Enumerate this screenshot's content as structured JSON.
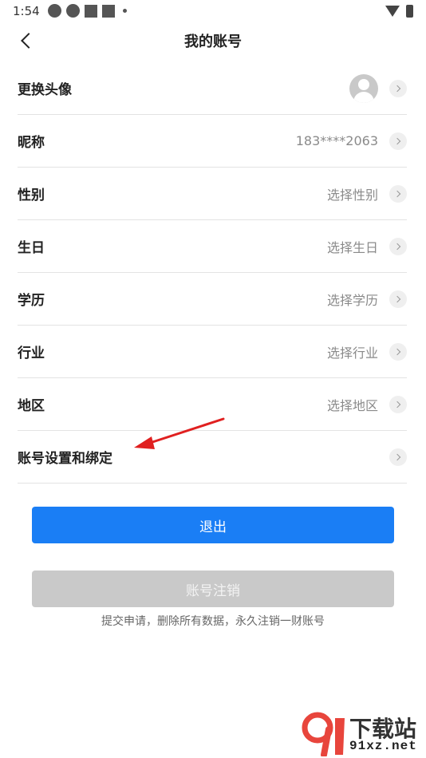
{
  "status_bar": {
    "time": "1:54",
    "left_icons": [
      "settings-icon",
      "browser-icon",
      "app-icon",
      "app-icon",
      "dot-icon"
    ],
    "right_icons": [
      "wifi-icon",
      "battery-icon"
    ]
  },
  "header": {
    "title": "我的账号",
    "back_icon": "chevron-left-icon"
  },
  "rows": [
    {
      "label": "更换头像",
      "value": "",
      "type": "avatar"
    },
    {
      "label": "昵称",
      "value": "183****2063"
    },
    {
      "label": "性别",
      "value": "选择性别"
    },
    {
      "label": "生日",
      "value": "选择生日"
    },
    {
      "label": "学历",
      "value": "选择学历"
    },
    {
      "label": "行业",
      "value": "选择行业"
    },
    {
      "label": "地区",
      "value": "选择地区"
    },
    {
      "label": "账号设置和绑定",
      "value": ""
    }
  ],
  "buttons": {
    "logout_label": "退出",
    "cancel_label": "账号注销",
    "cancel_note": "提交申请，删除所有数据，永久注销一财账号"
  },
  "colors": {
    "primary": "#1a7ef5",
    "disabled": "#c9c9c9",
    "annotation_arrow": "#e02020",
    "watermark_accent": "#e8453c"
  },
  "watermark": {
    "title": "下载站",
    "url": "91xz.net"
  }
}
